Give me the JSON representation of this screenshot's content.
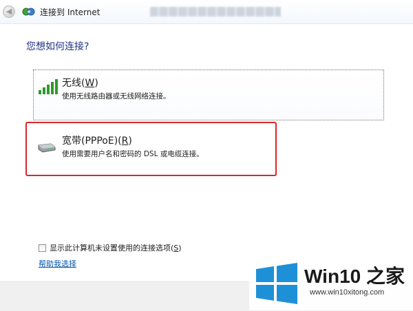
{
  "window": {
    "title": "连接到 Internet",
    "back_icon": "back-arrow-icon",
    "app_icon": "network-connection-icon"
  },
  "main": {
    "question": "您想如何连接?",
    "options": [
      {
        "title_prefix": "无线(",
        "accel": "W",
        "title_suffix": ")",
        "description": "使用无线路由器或无线网络连接。",
        "icon": "wireless-signal-icon"
      },
      {
        "title_prefix": "宽带(PPPoE)(",
        "accel": "R",
        "title_suffix": ")",
        "description": "使用需要用户名和密码的 DSL 或电缆连接。",
        "icon": "broadband-modem-icon",
        "highlight_color": "#d8262b"
      }
    ]
  },
  "footer": {
    "checkbox_prefix": "显示此计算机未设置使用的连接选项(",
    "checkbox_accel": "S",
    "checkbox_suffix": ")",
    "checkbox_checked": false,
    "help_link": "帮助我选择"
  },
  "watermark": {
    "brand": "Win10 之家",
    "url": "www.win10xitong.com",
    "logo_color": "#1e90d8"
  },
  "colors": {
    "heading": "#1e3287",
    "link": "#0055aa",
    "signal_green": "#2f9a2a"
  }
}
